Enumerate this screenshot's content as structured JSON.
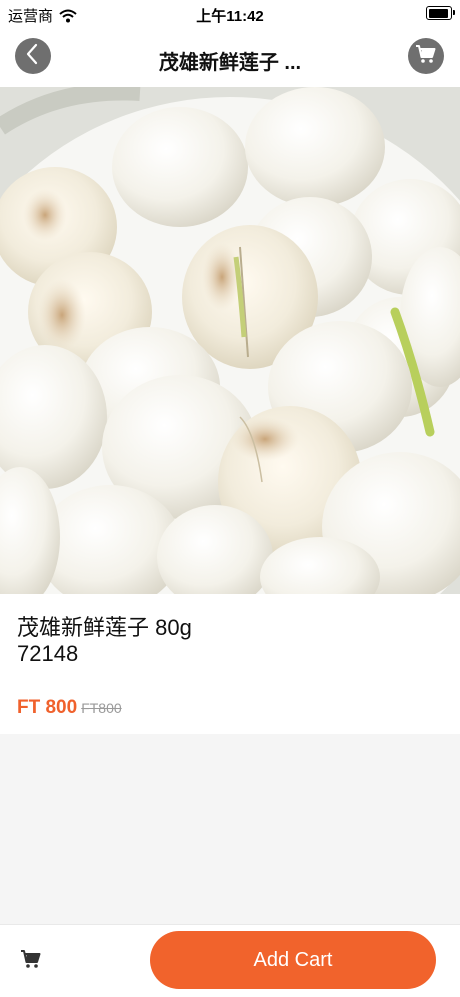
{
  "status_bar": {
    "carrier": "运营商",
    "time": "上午11:42"
  },
  "nav": {
    "title": "茂雄新鲜莲子 ...",
    "back_icon": "chevron-left-icon",
    "cart_icon": "shopping-cart-icon"
  },
  "product": {
    "name": "茂雄新鲜莲子 80g",
    "code": "72148",
    "price": "FT 800",
    "old_price": "FT800"
  },
  "bottom_bar": {
    "add_cart_label": "Add Cart",
    "cart_icon": "shopping-cart-icon"
  },
  "colors": {
    "accent": "#f1632c",
    "price": "#f0612c",
    "nav_button_bg": "#6f6f6f"
  }
}
